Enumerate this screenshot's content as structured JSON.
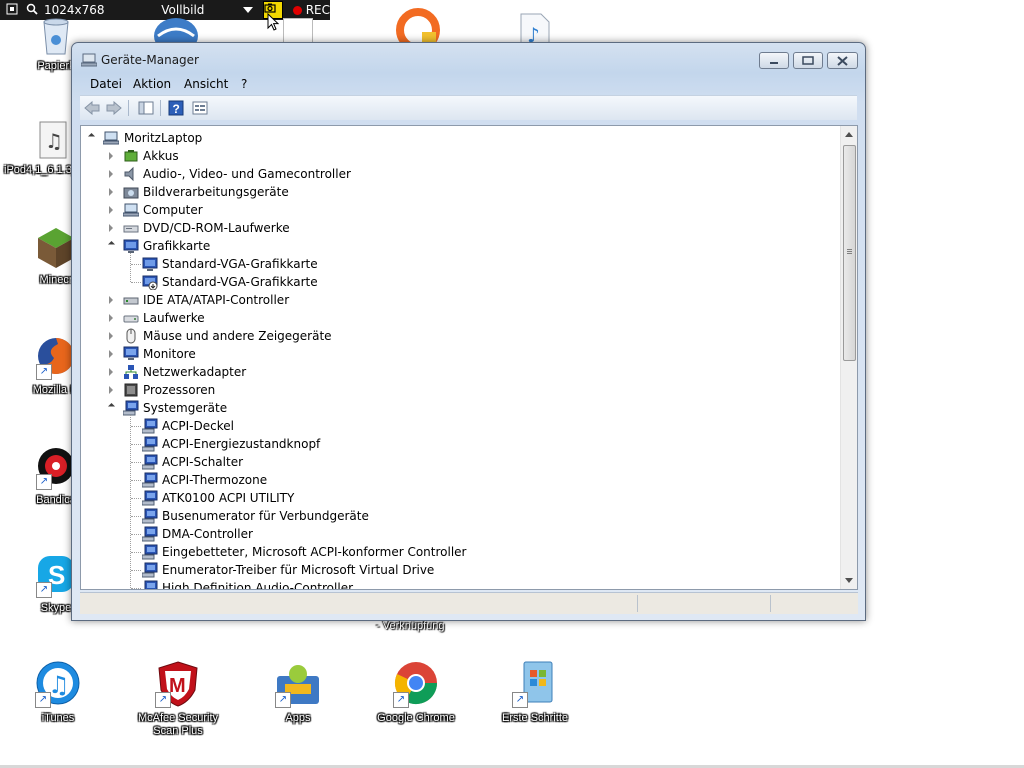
{
  "recorder": {
    "resolution": "1024x768",
    "mode": "Vollbild",
    "rec_label": "REC"
  },
  "desktop": {
    "icons": [
      {
        "label": "Papierk"
      },
      {
        "label": "iPod4,1_6.1.3_"
      },
      {
        "label": "Minecr"
      },
      {
        "label": "Mozilla Fi"
      },
      {
        "label": "Bandica"
      },
      {
        "label": "Skype"
      },
      {
        "label": "iTunes"
      },
      {
        "label": "McAfee Security Scan Plus"
      },
      {
        "label": "Apps"
      },
      {
        "label": "Google Chrome"
      },
      {
        "label": "Erste Schritte"
      }
    ],
    "partial_label": "- Verknüpfung"
  },
  "window": {
    "title": "Geräte-Manager",
    "menu": [
      "Datei",
      "Aktion",
      "Ansicht",
      "?"
    ],
    "tree": [
      {
        "level": 0,
        "state": "open",
        "label": "MoritzLaptop",
        "icon": "computer-icon"
      },
      {
        "level": 1,
        "state": "closed",
        "label": "Akkus",
        "icon": "battery-icon"
      },
      {
        "level": 1,
        "state": "closed",
        "label": "Audio-, Video- und Gamecontroller",
        "icon": "speaker-icon"
      },
      {
        "level": 1,
        "state": "closed",
        "label": "Bildverarbeitungsgeräte",
        "icon": "camera-icon"
      },
      {
        "level": 1,
        "state": "closed",
        "label": "Computer",
        "icon": "computer-icon"
      },
      {
        "level": 1,
        "state": "closed",
        "label": "DVD/CD-ROM-Laufwerke",
        "icon": "dvd-drive-icon"
      },
      {
        "level": 1,
        "state": "open",
        "label": "Grafikkarte",
        "icon": "display-adapter-icon"
      },
      {
        "level": 2,
        "state": "leaf",
        "label": "Standard-VGA-Grafikkarte",
        "icon": "display-adapter-icon"
      },
      {
        "level": 2,
        "state": "leaf",
        "label": "Standard-VGA-Grafikkarte",
        "icon": "display-adapter-disabled-icon"
      },
      {
        "level": 1,
        "state": "closed",
        "label": "IDE ATA/ATAPI-Controller",
        "icon": "ide-controller-icon"
      },
      {
        "level": 1,
        "state": "closed",
        "label": "Laufwerke",
        "icon": "disk-drive-icon"
      },
      {
        "level": 1,
        "state": "closed",
        "label": "Mäuse und andere Zeigegeräte",
        "icon": "mouse-icon"
      },
      {
        "level": 1,
        "state": "closed",
        "label": "Monitore",
        "icon": "monitor-icon"
      },
      {
        "level": 1,
        "state": "closed",
        "label": "Netzwerkadapter",
        "icon": "network-adapter-icon"
      },
      {
        "level": 1,
        "state": "closed",
        "label": "Prozessoren",
        "icon": "processor-icon"
      },
      {
        "level": 1,
        "state": "open",
        "label": "Systemgeräte",
        "icon": "system-device-icon"
      },
      {
        "level": 2,
        "state": "leaf",
        "label": "ACPI-Deckel",
        "icon": "system-device-icon"
      },
      {
        "level": 2,
        "state": "leaf",
        "label": "ACPI-Energiezustandknopf",
        "icon": "system-device-icon"
      },
      {
        "level": 2,
        "state": "leaf",
        "label": "ACPI-Schalter",
        "icon": "system-device-icon"
      },
      {
        "level": 2,
        "state": "leaf",
        "label": "ACPI-Thermozone",
        "icon": "system-device-icon"
      },
      {
        "level": 2,
        "state": "leaf",
        "label": "ATK0100 ACPI UTILITY",
        "icon": "system-device-icon"
      },
      {
        "level": 2,
        "state": "leaf",
        "label": "Busenumerator für Verbundgeräte",
        "icon": "system-device-icon"
      },
      {
        "level": 2,
        "state": "leaf",
        "label": "DMA-Controller",
        "icon": "system-device-icon"
      },
      {
        "level": 2,
        "state": "leaf",
        "label": "Eingebetteter, Microsoft ACPI-konformer Controller",
        "icon": "system-device-icon"
      },
      {
        "level": 2,
        "state": "leaf",
        "label": "Enumerator-Treiber für Microsoft Virtual Drive",
        "icon": "system-device-icon"
      },
      {
        "level": 2,
        "state": "leaf",
        "label": "High Definition Audio-Controller",
        "icon": "system-device-icon"
      }
    ]
  },
  "colors": {
    "window_frame": "#c3d6ec",
    "tree_bg": "#ffffff",
    "recorder_bg": "#1a1a1a",
    "rec_dot": "#e00000"
  }
}
